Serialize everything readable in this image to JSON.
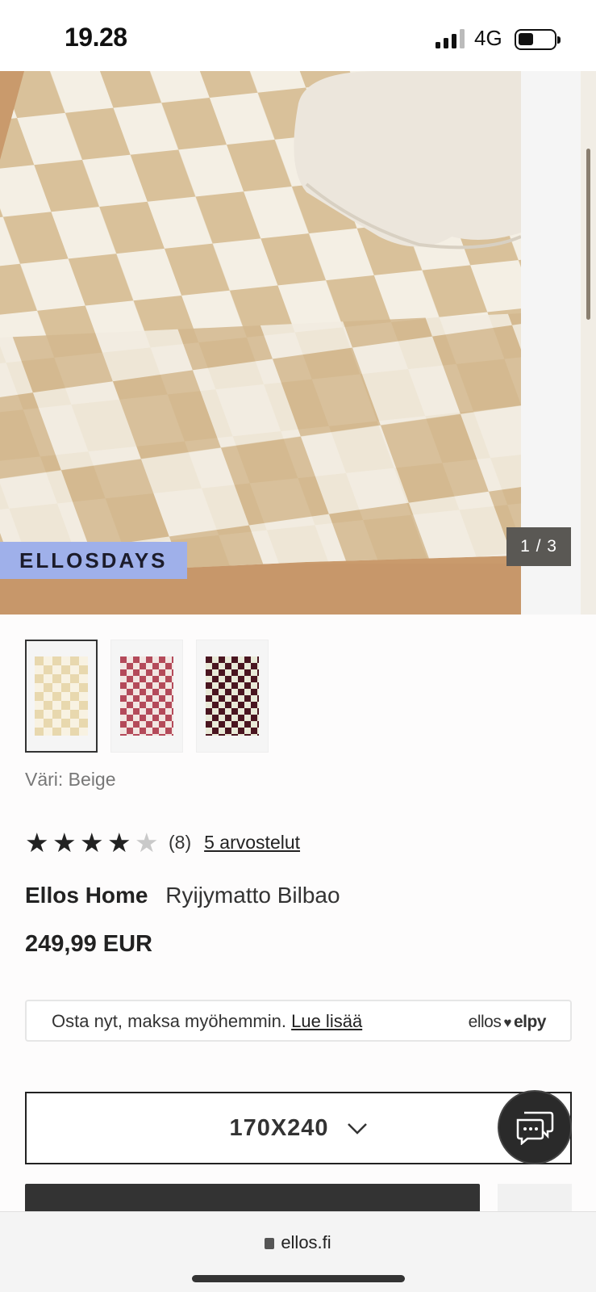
{
  "status_bar": {
    "time": "19.28",
    "network": "4G",
    "battery_level": 0.4
  },
  "gallery": {
    "promo_label": "ELLOSDAYS",
    "counter": "1 / 3",
    "accent_color": "#9fb0ea"
  },
  "thumbnails": [
    {
      "name": "beige",
      "colors": [
        "#efe2c3",
        "#f7f1e1"
      ],
      "selected": true
    },
    {
      "name": "pink",
      "colors": [
        "#b44a5a",
        "#f2e6e2"
      ],
      "selected": false
    },
    {
      "name": "burgundy",
      "colors": [
        "#4a1520",
        "#e9ead8"
      ],
      "selected": false
    }
  ],
  "color_label": "Väri: Beige",
  "rating": {
    "value": 4,
    "max": 5,
    "count_text": "(8)",
    "reviews_link": "5 arvostelut"
  },
  "product": {
    "brand": "Ellos Home",
    "name": "Ryijymatto Bilbao",
    "price": "249,99 EUR"
  },
  "pay_later": {
    "text": "Osta nyt, maksa myöhemmin.",
    "link": "Lue lisää",
    "logo_left": "ellos",
    "logo_right": "elpy"
  },
  "size_select": {
    "value": "170X240"
  },
  "browser": {
    "url": "ellos.fi"
  },
  "icons": [
    "signal-icon",
    "battery-icon",
    "chevron-down-icon",
    "chat-icon",
    "heart-icon",
    "lock-icon"
  ]
}
